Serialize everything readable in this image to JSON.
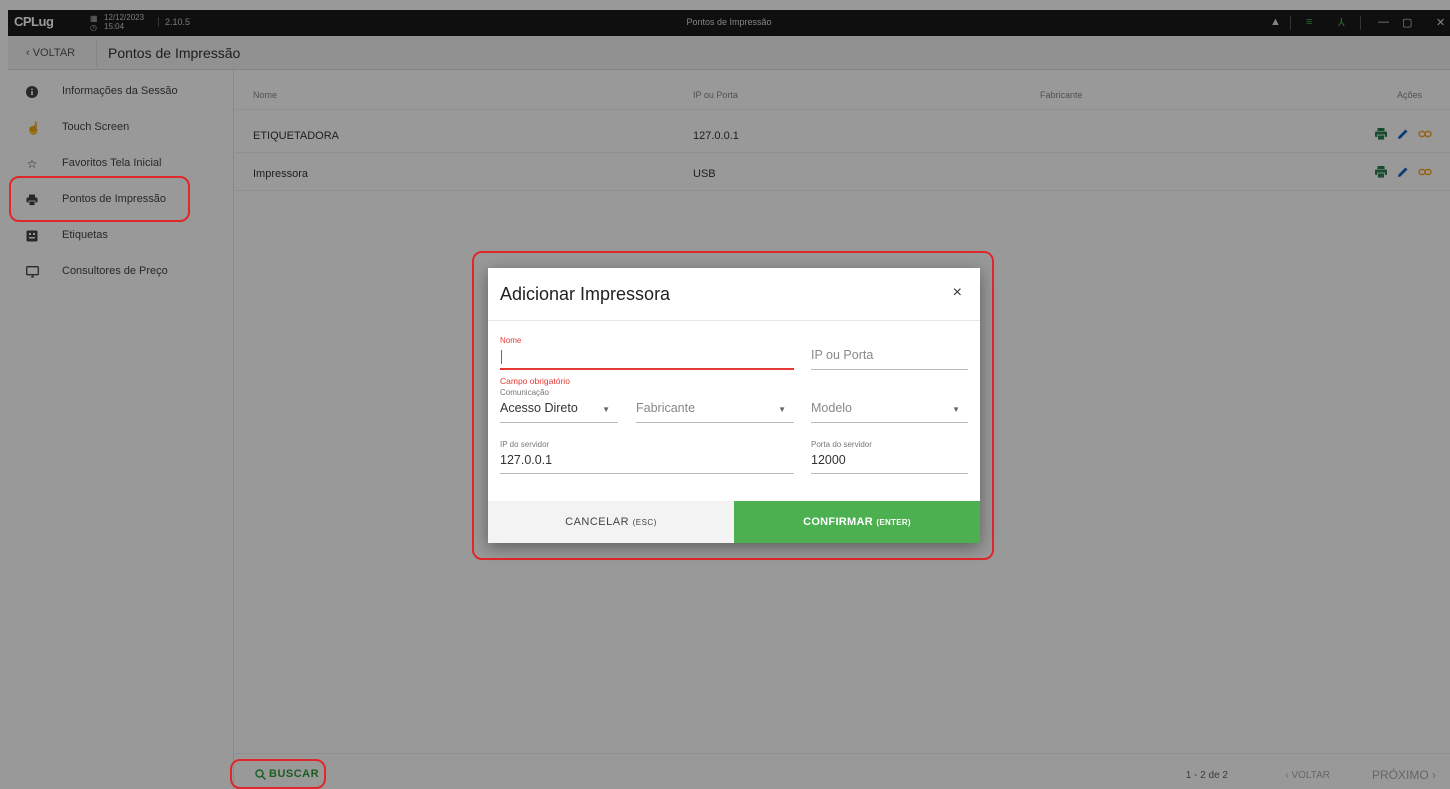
{
  "titlebar": {
    "logo": "CPLug",
    "date": "12/12/2023",
    "time": "15:04",
    "version": "2.10.5",
    "window_title": "Pontos de Impressão"
  },
  "header": {
    "back_label": "‹ VOLTAR",
    "page_title": "Pontos de Impressão"
  },
  "sidebar": {
    "items": [
      {
        "label": "Informações da Sessão",
        "icon": "info-icon"
      },
      {
        "label": "Touch Screen",
        "icon": "touch-icon"
      },
      {
        "label": "Favoritos Tela Inicial",
        "icon": "star-icon"
      },
      {
        "label": "Pontos de Impressão",
        "icon": "printer-icon"
      },
      {
        "label": "Etiquetas",
        "icon": "label-icon"
      },
      {
        "label": "Consultores de Preço",
        "icon": "monitor-icon"
      }
    ]
  },
  "table": {
    "columns": [
      "Nome",
      "IP ou Porta",
      "Fabricante",
      "Ações"
    ],
    "rows": [
      {
        "nome": "ETIQUETADORA",
        "ip": "127.0.0.1",
        "fabricante": ""
      },
      {
        "nome": "Impressora",
        "ip": "USB",
        "fabricante": ""
      }
    ]
  },
  "footer": {
    "buscar_label": "BUSCAR",
    "pagination": "1 - 2 de 2",
    "prev_label": "‹ VOLTAR",
    "next_label": "PRÓXIMO ›"
  },
  "dialog": {
    "title": "Adicionar Impressora",
    "close_glyph": "×",
    "nome_label": "Nome",
    "nome_value": "",
    "nome_error": "Campo obrigatório",
    "ip_porta_placeholder": "IP ou Porta",
    "comunicacao_label": "Comunicação",
    "comunicacao_value": "Acesso Direto",
    "fabricante_placeholder": "Fabricante",
    "modelo_placeholder": "Modelo",
    "ip_servidor_label": "IP do servidor",
    "ip_servidor_value": "127.0.0.1",
    "porta_servidor_label": "Porta do servidor",
    "porta_servidor_value": "12000",
    "cancel_label": "CANCELAR",
    "cancel_hint": "(ESC)",
    "confirm_label": "CONFIRMAR",
    "confirm_hint": "(ENTER)"
  },
  "colors": {
    "accent_green": "#4caf50",
    "error_red": "#e53935",
    "highlight_red": "#e0282a"
  }
}
